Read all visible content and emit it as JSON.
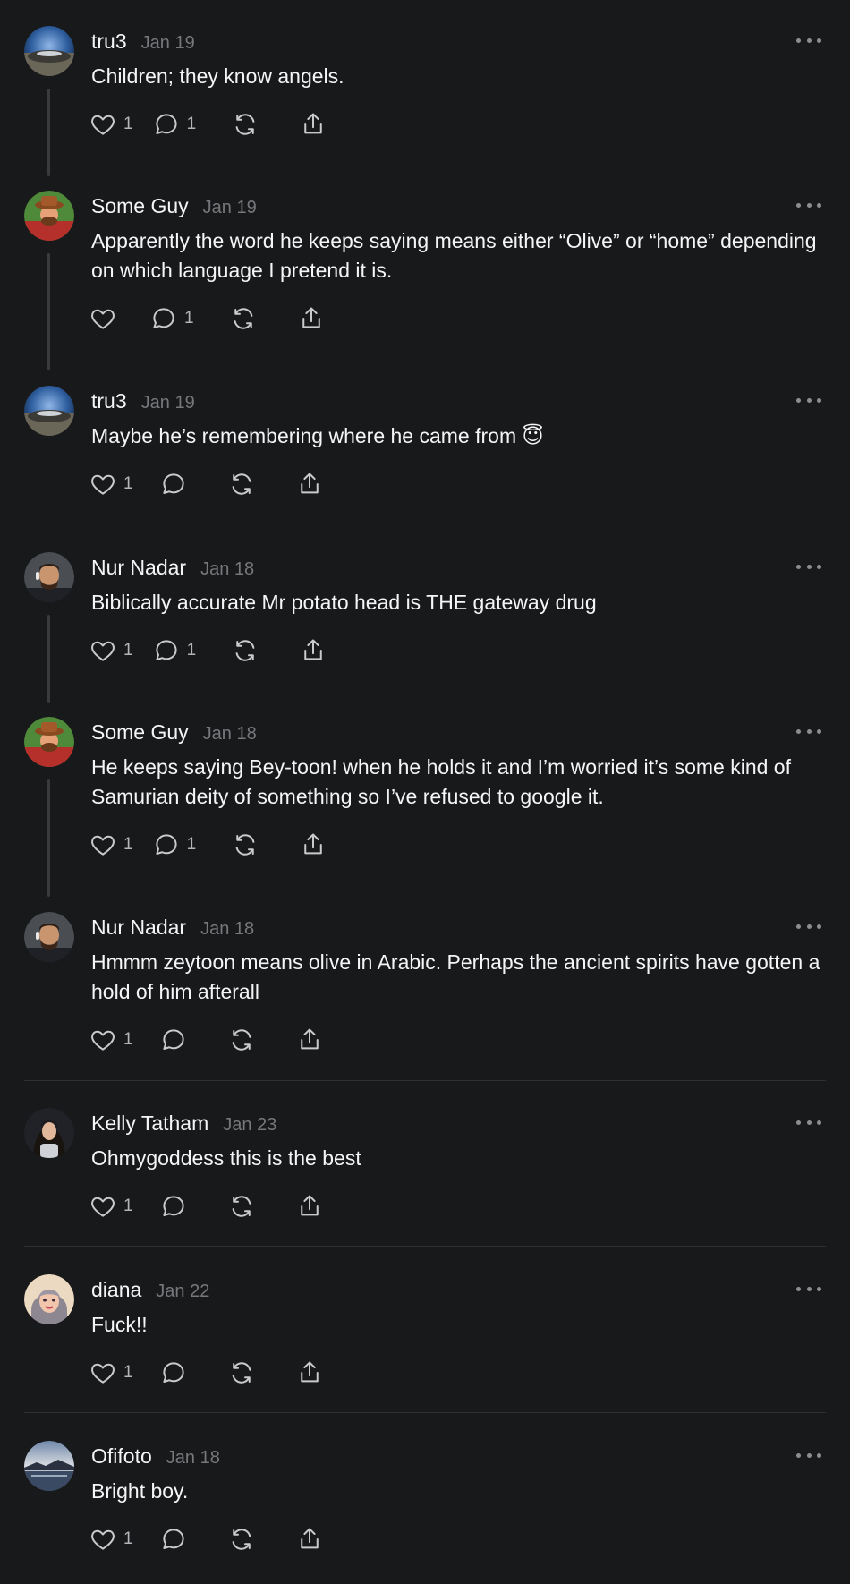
{
  "colors": {
    "background": "#18191b",
    "text_primary": "#f3f5f7",
    "text_secondary": "#77787b",
    "icon": "#c9cacc",
    "divider": "#2f3033",
    "thread_line": "#3a3b3e"
  },
  "icons": {
    "like": "heart-icon",
    "reply": "comment-icon",
    "repost": "repost-icon",
    "share": "share-icon",
    "more": "more-icon"
  },
  "posts": [
    {
      "author": "tru3",
      "date": "Jan 19",
      "text": "Children; they know angels.",
      "likes": "1",
      "replies": "1",
      "avatar": "globe"
    },
    {
      "author": "Some Guy",
      "date": "Jan 19",
      "text": "Apparently the word he keeps saying means either “Olive” or “home” depending on which language I pretend it is.",
      "likes": "",
      "replies": "1",
      "avatar": "cartoon"
    },
    {
      "author": "tru3",
      "date": "Jan 19",
      "text": "Maybe he’s remembering where he came from 😇",
      "likes": "1",
      "replies": "",
      "avatar": "globe"
    },
    {
      "author": "Nur Nadar",
      "date": "Jan 18",
      "text": "Biblically accurate Mr potato head is THE gateway drug",
      "likes": "1",
      "replies": "1",
      "avatar": "man"
    },
    {
      "author": "Some Guy",
      "date": "Jan 18",
      "text": "He keeps saying Bey-toon! when he holds it and I’m worried it’s some kind of Samurian deity of something so I’ve refused to google it.",
      "likes": "1",
      "replies": "1",
      "avatar": "cartoon"
    },
    {
      "author": "Nur Nadar",
      "date": "Jan 18",
      "text": "Hmmm zeytoon means olive in Arabic. Perhaps the ancient spirits have gotten a hold of him afterall",
      "likes": "1",
      "replies": "",
      "avatar": "man"
    },
    {
      "author": "Kelly Tatham",
      "date": "Jan 23",
      "text": "Ohmygoddess this is the best",
      "likes": "1",
      "replies": "",
      "avatar": "woman"
    },
    {
      "author": "diana",
      "date": "Jan 22",
      "text": "Fuck!!",
      "likes": "1",
      "replies": "",
      "avatar": "cartoon-woman"
    },
    {
      "author": "Ofifoto",
      "date": "Jan 18",
      "text": "Bright boy.",
      "likes": "1",
      "replies": "",
      "avatar": "landscape"
    }
  ]
}
